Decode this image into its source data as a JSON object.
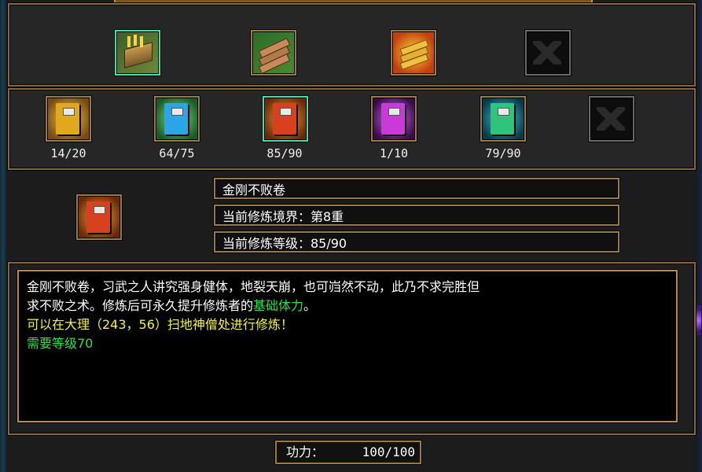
{
  "top_items": [
    {
      "name": "scroll-book-icon",
      "selected": true,
      "empty": false
    },
    {
      "name": "scroll-bundle-icon",
      "selected": false,
      "empty": false
    },
    {
      "name": "golden-scrolls-icon",
      "selected": false,
      "empty": false
    },
    {
      "name": "empty-slot-icon",
      "selected": false,
      "empty": true
    }
  ],
  "books": [
    {
      "count": "14/20",
      "color": "#e0a81a",
      "burst": "#f2c84a"
    },
    {
      "count": "64/75",
      "color": "#2aa6e6",
      "burst": "#7ee07a"
    },
    {
      "count": "85/90",
      "color": "#d8401e",
      "burst": "#f0a030"
    },
    {
      "count": "1/10",
      "color": "#c93ad8",
      "burst": "#d070f0"
    },
    {
      "count": "79/90",
      "color": "#2ec57a",
      "burst": "#40c0e0"
    }
  ],
  "selected_book": {
    "name": "金刚不败卷",
    "realm": "当前修炼境界：第8重",
    "level": "当前修炼等级：85/90"
  },
  "description": {
    "line1_white": "金刚不败卷，习武之人讲究强身健体，地裂天崩，也可岿然不动，此乃不求完胜但",
    "line2_white": "求不败之术。修炼后可永久提升修炼者的",
    "line2_green": "基础体力",
    "line2_end": "。",
    "line3_yellow": "可以在大理（243，56）扫地神僧处进行修炼！",
    "line4_green": "需要等级70"
  },
  "power": {
    "label": "功力：",
    "value": "100/100"
  }
}
